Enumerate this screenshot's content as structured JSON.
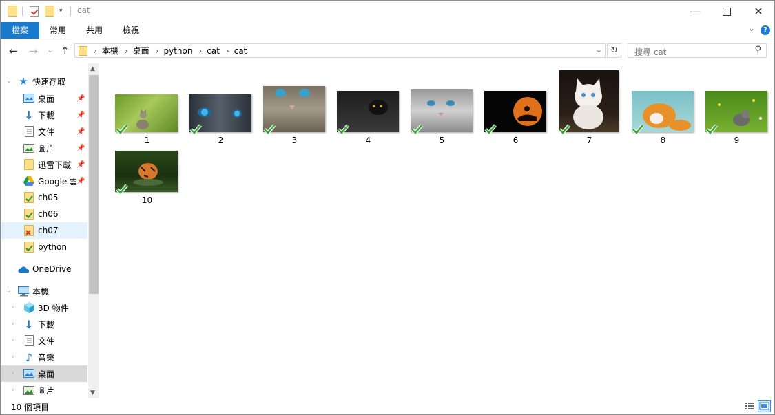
{
  "window": {
    "title": "cat",
    "controls": {
      "minimize_icon": "minimize-icon",
      "maximize_icon": "maximize-icon",
      "close_icon": "close-icon"
    }
  },
  "ribbon": {
    "tabs": [
      "檔案",
      "常用",
      "共用",
      "檢視"
    ],
    "active_tab": "檔案",
    "accent_color": "#1979ca"
  },
  "address": {
    "crumbs": [
      "本機",
      "桌面",
      "python",
      "cat",
      "cat"
    ]
  },
  "search": {
    "placeholder": "搜尋 cat"
  },
  "nav": {
    "quick_access": {
      "label": "快速存取",
      "items": [
        {
          "label": "桌面",
          "icon": "desktop-icon",
          "pinned": true
        },
        {
          "label": "下載",
          "icon": "download-icon",
          "pinned": true
        },
        {
          "label": "文件",
          "icon": "document-icon",
          "pinned": true
        },
        {
          "label": "圖片",
          "icon": "pictures-icon",
          "pinned": true
        },
        {
          "label": "迅雷下載",
          "icon": "folder-icon",
          "pinned": true
        },
        {
          "label": "Google 雲",
          "icon": "google-drive-icon",
          "pinned": true
        },
        {
          "label": "ch05",
          "icon": "synced-folder-icon",
          "pinned": false
        },
        {
          "label": "ch06",
          "icon": "synced-folder-icon",
          "pinned": false
        },
        {
          "label": "ch07",
          "icon": "sync-error-folder-icon",
          "pinned": false
        },
        {
          "label": "python",
          "icon": "synced-folder-icon",
          "pinned": false
        }
      ]
    },
    "onedrive": {
      "label": "OneDrive"
    },
    "this_pc": {
      "label": "本機",
      "items": [
        {
          "label": "3D 物件",
          "icon": "3d-objects-icon"
        },
        {
          "label": "下載",
          "icon": "download-icon"
        },
        {
          "label": "文件",
          "icon": "document-icon"
        },
        {
          "label": "音樂",
          "icon": "music-icon"
        },
        {
          "label": "桌面",
          "icon": "desktop-icon"
        },
        {
          "label": "圖片",
          "icon": "pictures-icon"
        }
      ]
    }
  },
  "files": [
    {
      "name": "1",
      "synced": true
    },
    {
      "name": "2",
      "synced": true
    },
    {
      "name": "3",
      "synced": true
    },
    {
      "name": "4",
      "synced": true
    },
    {
      "name": "5",
      "synced": true
    },
    {
      "name": "6",
      "synced": true
    },
    {
      "name": "7",
      "synced": true
    },
    {
      "name": "8",
      "synced": true
    },
    {
      "name": "9",
      "synced": true
    },
    {
      "name": "10",
      "synced": true
    }
  ],
  "status": {
    "item_count": "10 個項目"
  }
}
